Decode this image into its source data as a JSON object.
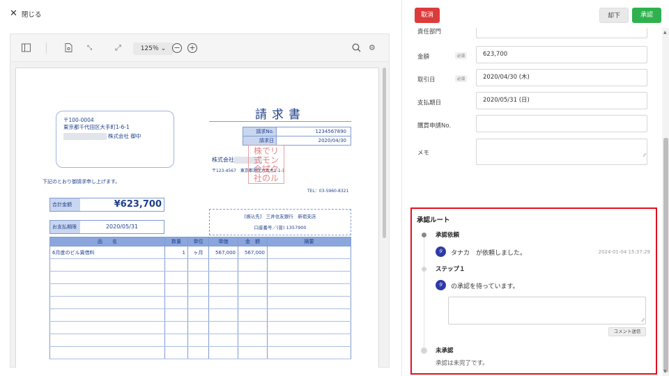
{
  "header": {
    "close_label": "閉じる"
  },
  "viewer": {
    "zoom": "125％",
    "toolbar_icons": [
      "sidebar-toggle-icon",
      "document-icon",
      "fit-page-icon",
      "expand-icon",
      "zoom-out-icon",
      "zoom-in-icon",
      "search-icon",
      "settings-icon"
    ]
  },
  "invoice": {
    "postal": "〒100-0004",
    "address": "東京都千代田区大手町1-6-1",
    "addressee_suffix": "株式会社 御中",
    "title": "請求書",
    "info": [
      {
        "label": "請求No.",
        "value": "1234567890"
      },
      {
        "label": "請求日",
        "value": "2020/04/30"
      }
    ],
    "issuer_prefix": "株式会社",
    "issuer_address": "〒123-4567　東京都港区六本木1-1-1",
    "stamp_text": "株でリ\n式モン\n会試ク\n社のル",
    "note": "下記のとおり御請求申し上げます。",
    "tel": "TEL：03-5960-8321",
    "total_label": "合計金額",
    "total_value": "¥623,700",
    "bank_line1": "[振込先]　三井住友銀行　新宿支店",
    "bank_line2": "口座番号／(普) 1357900",
    "due_label": "お支払期限",
    "due_value": "2020/05/31",
    "headers": [
      "品　　名",
      "数量",
      "単位",
      "単価",
      "金　額",
      "摘要"
    ],
    "rows": [
      [
        "6月度のビル賃借料",
        "1",
        "ヶ月",
        "567,000",
        "567,000",
        ""
      ],
      [
        "",
        "",
        "",
        "",
        "",
        ""
      ],
      [
        "",
        "",
        "",
        "",
        "",
        ""
      ],
      [
        "",
        "",
        "",
        "",
        "",
        ""
      ],
      [
        "",
        "",
        "",
        "",
        "",
        ""
      ],
      [
        "",
        "",
        "",
        "",
        "",
        ""
      ],
      [
        "",
        "",
        "",
        "",
        "",
        ""
      ],
      [
        "",
        "",
        "",
        "",
        "",
        ""
      ],
      [
        "",
        "",
        "",
        "",
        "",
        ""
      ]
    ]
  },
  "actions": {
    "cancel": "取消",
    "reject": "却下",
    "approve": "承認"
  },
  "form": {
    "partial_label": "責任部門",
    "required_badge": "必須",
    "fields": [
      {
        "label": "金額",
        "required": true,
        "value": "623,700"
      },
      {
        "label": "取引日",
        "required": true,
        "value": "2020/04/30 (木)"
      },
      {
        "label": "支払期日",
        "required": false,
        "value": "2020/05/31 (日)"
      },
      {
        "label": "購買申請No.",
        "required": false,
        "value": ""
      }
    ],
    "memo_label": "メモ"
  },
  "route": {
    "title": "承認ルート",
    "stage1": "承認依頼",
    "requester_avatar": "タ",
    "requester_message": "タナカ　が依頼しました。",
    "requested_at": "2024-01-04 15:37:29",
    "stage2": "ステップ１",
    "waiting_avatar": "タ",
    "waiting_message": "の承認を待っています。",
    "comment_button": "コメント送信",
    "stage3": "未承認",
    "stage3_status": "承認は未完了です。"
  },
  "colors": {
    "highlight_border": "#e0101f",
    "approve": "#2fb24e",
    "cancel": "#dc3b3b",
    "avatar": "#2e3aa6"
  }
}
